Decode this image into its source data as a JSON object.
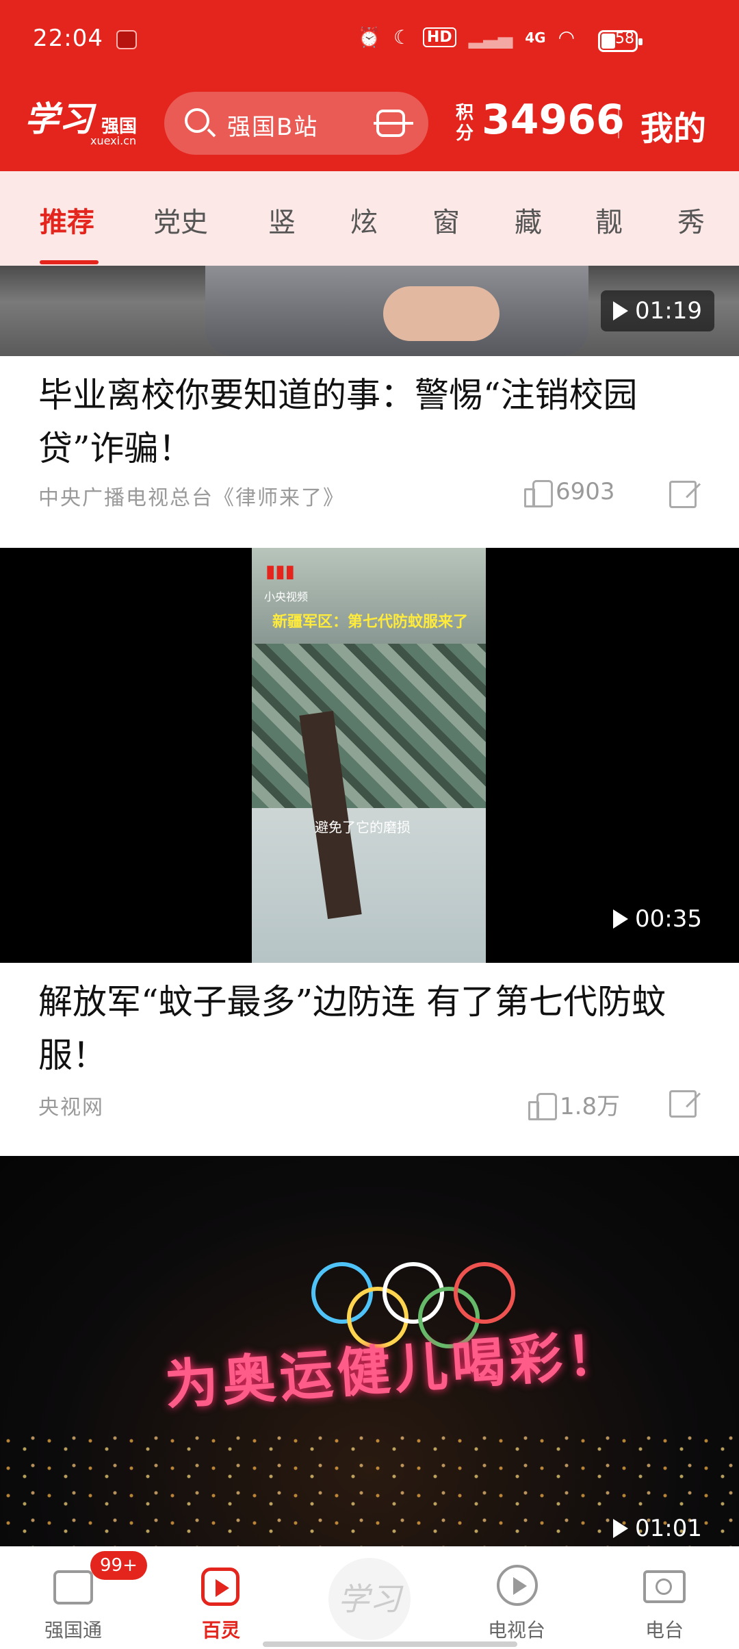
{
  "status_bar": {
    "time": "22:04",
    "network": "4G",
    "hd": "HD",
    "battery": "58"
  },
  "app_bar": {
    "logo_main": "学习",
    "logo_sub": "强国",
    "logo_domain": "xuexi.cn",
    "search_placeholder": "强国B站",
    "points_label": "积分",
    "points_value": "34966",
    "mine_label": "我的"
  },
  "tabs": [
    {
      "label": "推荐",
      "active": true
    },
    {
      "label": "党史"
    },
    {
      "label": "竖"
    },
    {
      "label": "炫"
    },
    {
      "label": "窗"
    },
    {
      "label": "藏"
    },
    {
      "label": "靓"
    },
    {
      "label": "秀"
    }
  ],
  "feed": [
    {
      "duration": "01:19",
      "title": "毕业离校你要知道的事：警惕“注销校园贷”诈骗！",
      "source": "中央广播电视总台《律师来了》",
      "likes": "6903"
    },
    {
      "duration": "00:35",
      "overlay_brand": "小央视频",
      "overlay_title": "新疆军区：第七代防蚊服来了",
      "overlay_caption": "避免了它的磨损",
      "title": "解放军“蚊子最多”边防连 有了第七代防蚊服！",
      "source": "央视网",
      "likes": "1.8万"
    },
    {
      "duration": "01:01",
      "overlay_text": "为奥运健儿喝彩！"
    }
  ],
  "bottom_nav": [
    {
      "label": "强国通",
      "badge": "99+"
    },
    {
      "label": "百灵",
      "active": true
    },
    {
      "label": "学习"
    },
    {
      "label": "电视台"
    },
    {
      "label": "电台"
    }
  ],
  "colors": {
    "brand_red": "#e3251d",
    "tab_bg": "#fce8e6",
    "muted_text": "#9a9a9a"
  }
}
